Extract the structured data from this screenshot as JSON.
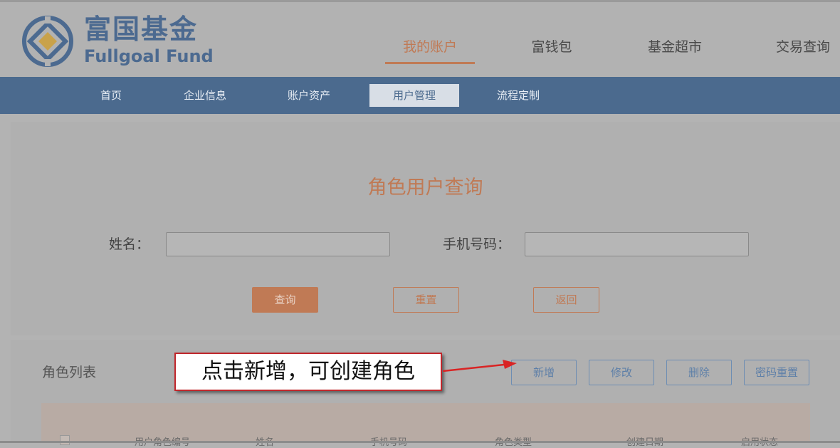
{
  "brand": {
    "name_cn": "富国基金",
    "name_en": "Fullgoal Fund"
  },
  "main_nav": [
    {
      "label": "我的账户",
      "active": true
    },
    {
      "label": "富钱包",
      "active": false
    },
    {
      "label": "基金超市",
      "active": false
    },
    {
      "label": "交易查询",
      "active": false
    }
  ],
  "sub_nav": [
    {
      "label": "首页",
      "active": false
    },
    {
      "label": "企业信息",
      "active": false
    },
    {
      "label": "账户资产",
      "active": false
    },
    {
      "label": "用户管理",
      "active": true
    },
    {
      "label": "流程定制",
      "active": false
    }
  ],
  "query": {
    "title": "角色用户查询",
    "name_label": "姓名：",
    "name_value": "",
    "phone_label": "手机号码：",
    "phone_value": "",
    "btn_search": "查询",
    "btn_reset": "重置",
    "btn_back": "返回"
  },
  "list": {
    "title": "角色列表",
    "btn_add": "新增",
    "btn_edit": "修改",
    "btn_delete": "删除",
    "btn_reset_pwd": "密码重置",
    "columns": [
      "用户角色编号",
      "姓名",
      "手机号码",
      "角色类型",
      "创建日期",
      "启用状态"
    ]
  },
  "annotation": {
    "text": "点击新增，可创建角色"
  },
  "colors": {
    "accent_orange": "#c07a55",
    "nav_blue": "#4b6a8e",
    "callout_border": "#c0262b"
  }
}
